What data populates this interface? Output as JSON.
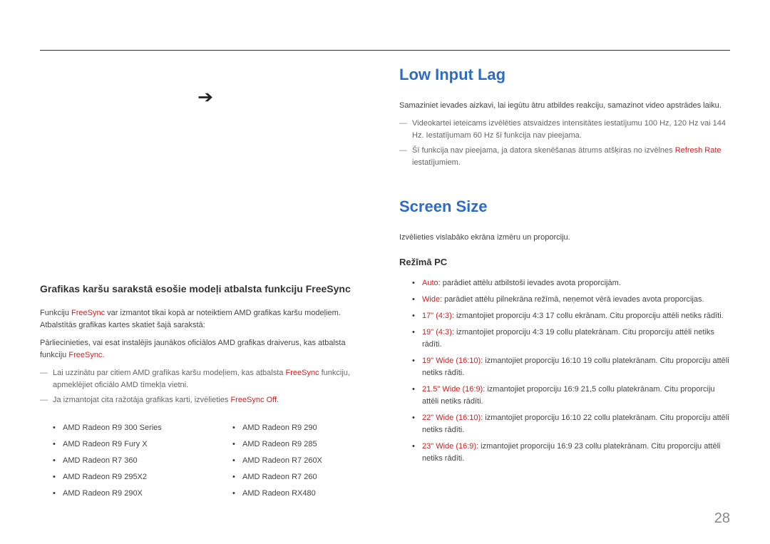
{
  "arrow_glyph": "➔",
  "left": {
    "section_heading": "Grafikas karšu sarakstā esošie modeļi atbalsta funkciju FreeSync",
    "p1_a": "Funkciju ",
    "p1_red": "FreeSync",
    "p1_b": " var izmantot tikai kopā ar noteiktiem AMD grafikas karšu modeļiem. Atbalstītās grafikas kartes skatiet šajā sarakstā:",
    "p2_a": "Pārliecinieties, vai esat instalējis jaunākos oficiālos AMD grafikas draiverus, kas atbalsta funkciju ",
    "p2_red": "FreeSync.",
    "note1_a": "Lai uzzinātu par citiem AMD grafikas karšu modeļiem, kas atbalsta ",
    "note1_red": "FreeSync",
    "note1_b": " funkciju, apmeklējiet oficiālo AMD tīmekļa vietni.",
    "note2_a": "Ja izmantojat cita ražotāja grafikas karti, izvēlieties ",
    "note2_red": "FreeSync Off",
    "note2_b": ".",
    "cards_left": [
      "AMD Radeon R9 300 Series",
      "AMD Radeon R9 Fury X",
      "AMD Radeon R7 360",
      "AMD Radeon R9 295X2",
      "AMD Radeon R9 290X"
    ],
    "cards_right": [
      "AMD Radeon R9 290",
      "AMD Radeon R9 285",
      "AMD Radeon R7 260X",
      "AMD Radeon R7 260",
      "AMD Radeon RX480"
    ]
  },
  "right": {
    "h_low_input": "Low Input Lag",
    "low_input_p": "Samaziniet ievades aizkavi, lai iegūtu ātru atbildes reakciju, samazinot video apstrādes laiku.",
    "low_note1": "Videokartei ieteicams izvēlēties atsvaidzes intensitātes iestatījumu 100 Hz, 120 Hz vai 144 Hz. Iestatījumam 60 Hz šī funkcija nav pieejama.",
    "low_note2_a": "Šī funkcija nav pieejama, ja datora skenēšanas ātrums atšķiras no izvēlnes ",
    "low_note2_red": "Refresh Rate",
    "low_note2_b": " iestatījumiem.",
    "h_screen": "Screen Size",
    "screen_p": "Izvēlieties vislabāko ekrāna izmēru un proporciju.",
    "h_mode": "Režīmā PC",
    "modes": [
      {
        "label": "Auto",
        "text": ": parādiet attēlu atbilstoši ievades avota proporcijām."
      },
      {
        "label": "Wide",
        "text": ": parādiet attēlu pilnekrāna režīmā, neņemot vērā ievades avota proporcijas."
      },
      {
        "label": "17\" (4:3)",
        "text": ": izmantojiet proporciju 4:3 17 collu ekrānam. Citu proporciju attēli netiks rādīti."
      },
      {
        "label": "19\" (4:3)",
        "text": ": izmantojiet proporciju 4:3 19 collu platekrānam. Citu proporciju attēli netiks rādīti."
      },
      {
        "label": "19\" Wide (16:10)",
        "text": ": izmantojiet proporciju 16:10 19 collu platekrānam. Citu proporciju attēli netiks rādīti."
      },
      {
        "label": "21.5\" Wide (16:9)",
        "text": ": izmantojiet proporciju 16:9 21,5 collu platekrānam. Citu proporciju attēli netiks rādīti."
      },
      {
        "label": "22\" Wide (16:10)",
        "text": ": izmantojiet proporciju 16:10 22 collu platekrānam. Citu proporciju attēli netiks rādīti."
      },
      {
        "label": "23\" Wide (16:9)",
        "text": ": izmantojiet proporciju 16:9 23 collu platekrānam. Citu proporciju attēli netiks rādīti."
      }
    ]
  },
  "page_number": "28"
}
